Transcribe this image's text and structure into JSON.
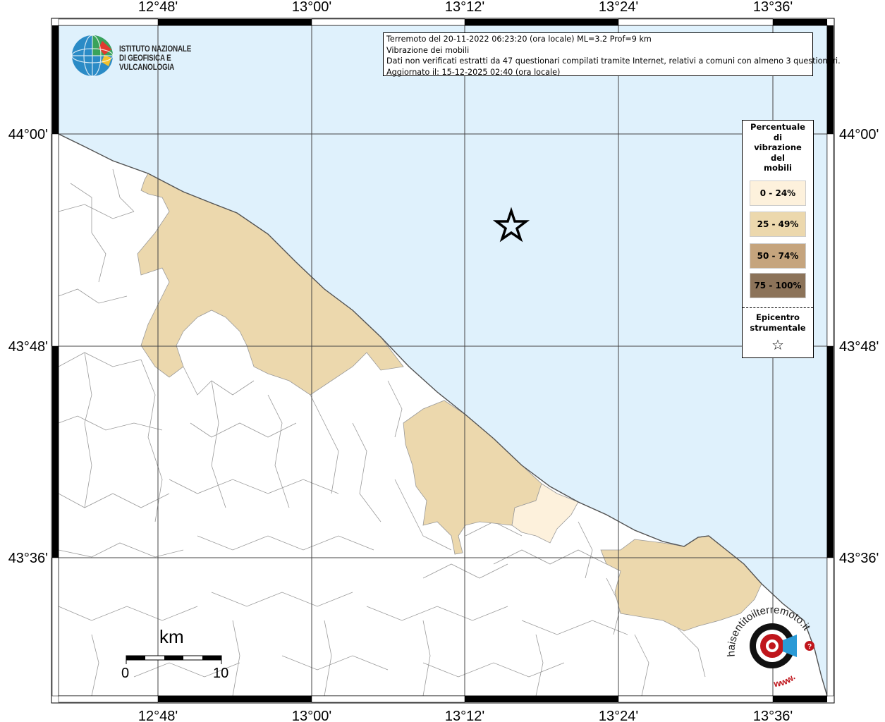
{
  "map": {
    "top_labels": [
      "12°48'",
      "13°00'",
      "13°12'",
      "13°24'",
      "13°36'"
    ],
    "bottom_labels": [
      "12°48'",
      "13°00'",
      "13°12'",
      "13°24'",
      "13°36'"
    ],
    "left_labels": [
      "44°00'",
      "43°48'",
      "43°36'"
    ],
    "right_labels": [
      "44°00'",
      "43°48'",
      "43°36'"
    ],
    "colors": {
      "sea": "#dff1fc",
      "land": "#ffffff",
      "class_0_24": "#fdf1dc",
      "class_25_49": "#ecd8ad",
      "class_50_74": "#c5a47d",
      "class_75_100": "#8c7359",
      "boundaries": "#9a9a9a"
    },
    "epicenter_symbol": "star-icon"
  },
  "logo": {
    "line1": "ISTITUTO NAZIONALE",
    "line2": "DI GEOFISICA E VULCANOLOGIA"
  },
  "info": {
    "line1": "Terremoto del 20-11-2022 06:23:20 (ora locale) ML=3.2 Prof=9 km",
    "line2": "Vibrazione dei mobili",
    "line3": "Dati non verificati estratti da 47 questionari compilati tramite Internet, relativi a comuni con almeno 3 questionari.",
    "line4": "Aggiornato il: 15-12-2025 02:40 (ora locale)"
  },
  "legend": {
    "title_lines": [
      "Percentuale",
      "di",
      "vibrazione",
      "del",
      "mobili"
    ],
    "classes": [
      {
        "label": "0 - 24%",
        "color": "#fdf1dc"
      },
      {
        "label": "25 - 49%",
        "color": "#ecd8ad"
      },
      {
        "label": "50 - 74%",
        "color": "#c5a47d"
      },
      {
        "label": "75 - 100%",
        "color": "#8c7359"
      }
    ],
    "epicenter_lines": [
      "Epicentro",
      "strumentale"
    ],
    "epicenter_symbol": "☆"
  },
  "scalebar": {
    "unit": "km",
    "start": "0",
    "end": "10"
  },
  "hst_logo": {
    "top_text": "haisentitoilterremoto.it",
    "bottom_text": "www."
  }
}
